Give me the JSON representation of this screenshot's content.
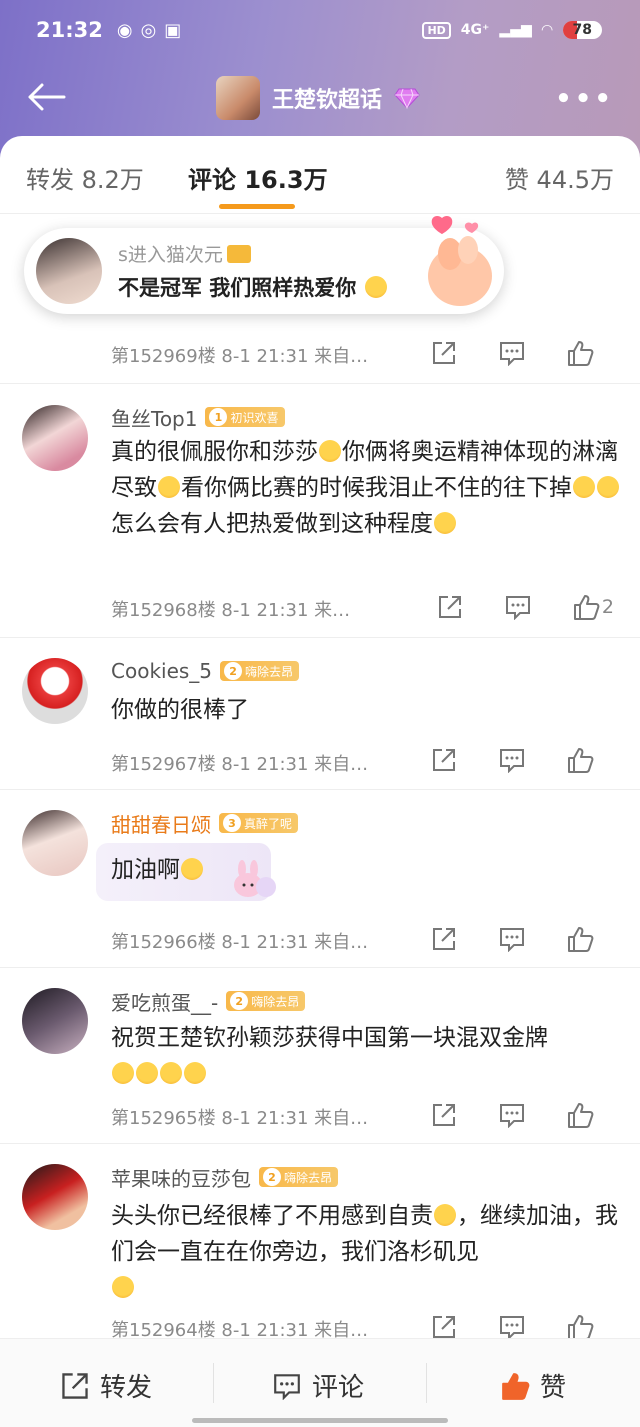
{
  "status_bar": {
    "time": "21:32",
    "hd": "HD",
    "network": "4G⁺",
    "battery": "78"
  },
  "nav": {
    "title": "王楚钦超话"
  },
  "tabs": [
    {
      "label": "转发 8.2万"
    },
    {
      "label": "评论 16.3万"
    },
    {
      "label": "赞 44.5万"
    }
  ],
  "toast": {
    "line1": "s进入猫次元",
    "line2": "不是冠军 我们照样热爱你"
  },
  "comments": [
    {
      "meta": "第152969楼 8-1 21:31 来自…",
      "likes": ""
    },
    {
      "name": "鱼丝Top1",
      "badge_level": "1",
      "badge": "初识欢喜",
      "text": "真的很佩服你和莎莎",
      "text2": "你俩将奥运精神体现的淋漓尽致",
      "text3": "看你俩比赛的时候我泪止不住的往下掉",
      "text4": "怎么会有人把热爱做到这种程度",
      "meta": "第152968楼 8-1 21:31 来…",
      "likes": "2"
    },
    {
      "name": "Cookies_5",
      "badge_level": "2",
      "badge": "嗨除去昂",
      "text": "你做的很棒了",
      "meta": "第152967楼 8-1 21:31 来自…",
      "likes": ""
    },
    {
      "name": "甜甜春日颂",
      "badge_level": "3",
      "badge": "真醉了呢",
      "text": "加油啊",
      "meta": "第152966楼 8-1 21:31 来自…",
      "likes": ""
    },
    {
      "name": "爱吃煎蛋__-",
      "badge_level": "2",
      "badge": "嗨除去昂",
      "text": "祝贺王楚钦孙颖莎获得中国第一块混双金牌",
      "meta": "第152965楼 8-1 21:31 来自…",
      "likes": ""
    },
    {
      "name": "苹果味的豆莎包",
      "badge_level": "2",
      "badge": "嗨除去昂",
      "text": "头头你已经很棒了不用感到自责",
      "text2": "，继续加油，我们会一直在在你旁边，我们洛杉矶见",
      "meta": "第152964楼 8-1 21:31 来自…",
      "likes": ""
    }
  ],
  "bottom_bar": {
    "repost": "转发",
    "comment": "评论",
    "like": "赞"
  },
  "colors": {
    "accent": "#f59a1c",
    "header_start": "#7d70c8",
    "header_end": "#b89ab8",
    "like_active": "#f0642a"
  }
}
